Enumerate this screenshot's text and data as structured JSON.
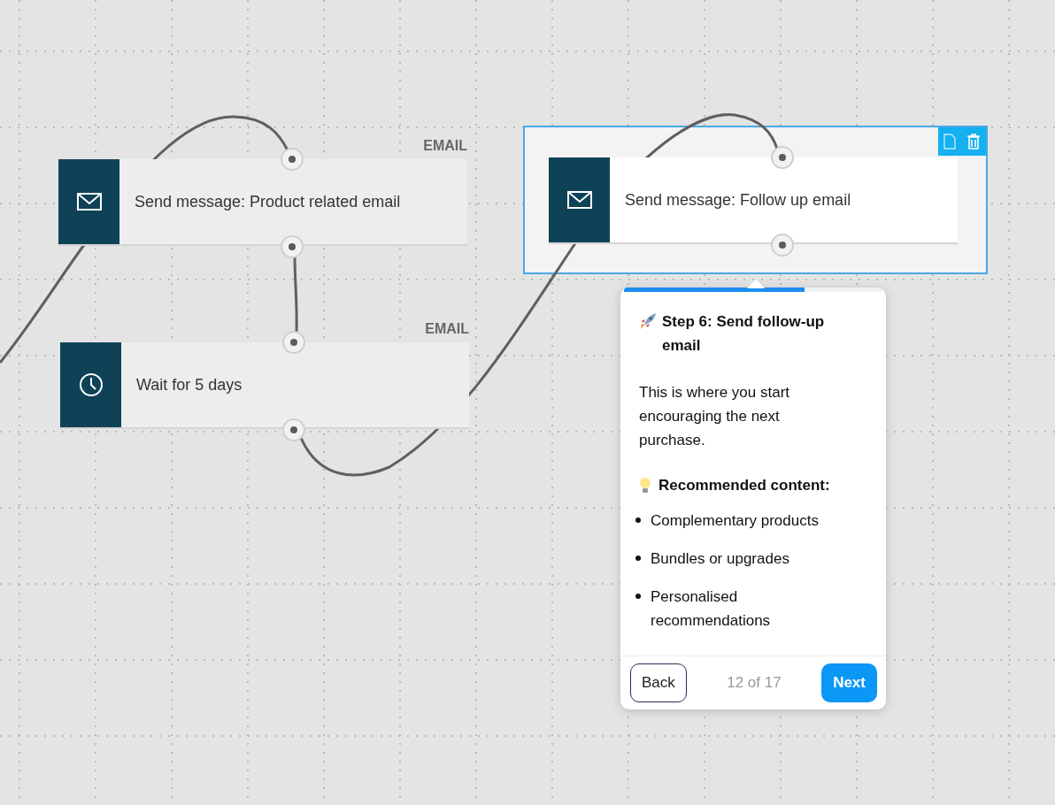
{
  "nodes": [
    {
      "kind": "email",
      "label": "Send message: Product related email",
      "tag": "EMAIL",
      "selected": false
    },
    {
      "kind": "wait",
      "label": "Wait for 5 days",
      "tag": "EMAIL",
      "selected": false
    },
    {
      "kind": "email",
      "label": "Send message: Follow up email",
      "selected": true
    }
  ],
  "tour": {
    "level": 0.7,
    "title": "Step 6: Send follow-up email",
    "body": "This is where you start encouraging the next purchase.",
    "heading": "Recommended content:",
    "items": [
      "Complementary products",
      "Bundles or upgrades",
      "Personalised recommendations"
    ],
    "back": "Back",
    "counter": "12 of 17",
    "next": "Next"
  }
}
